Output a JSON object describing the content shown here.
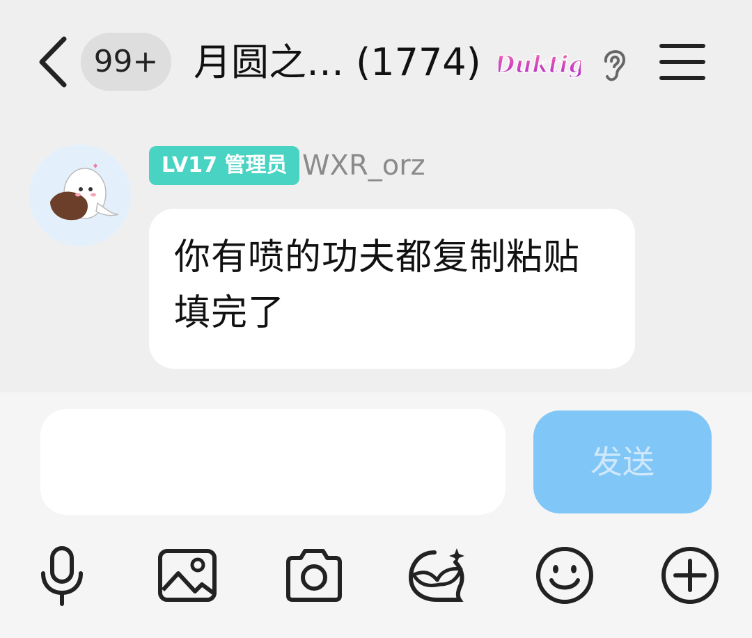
{
  "header": {
    "unread_badge": "99+",
    "title": "月圆之… (1774)",
    "brand_text": "Duktig"
  },
  "message": {
    "level_badge": "LV17 管理员",
    "username": "WXR_orz",
    "text": "你有喷的功夫都复制粘贴填完了"
  },
  "composer": {
    "input_value": "",
    "send_label": "发送"
  },
  "toolbar": {
    "icons": [
      "microphone-icon",
      "image-icon",
      "camera-icon",
      "mask-sticker-icon",
      "emoji-icon",
      "plus-icon"
    ]
  },
  "colors": {
    "level_badge_bg": "#49d3c3",
    "send_button_bg": "#80c6f7",
    "background": "#efefef"
  }
}
